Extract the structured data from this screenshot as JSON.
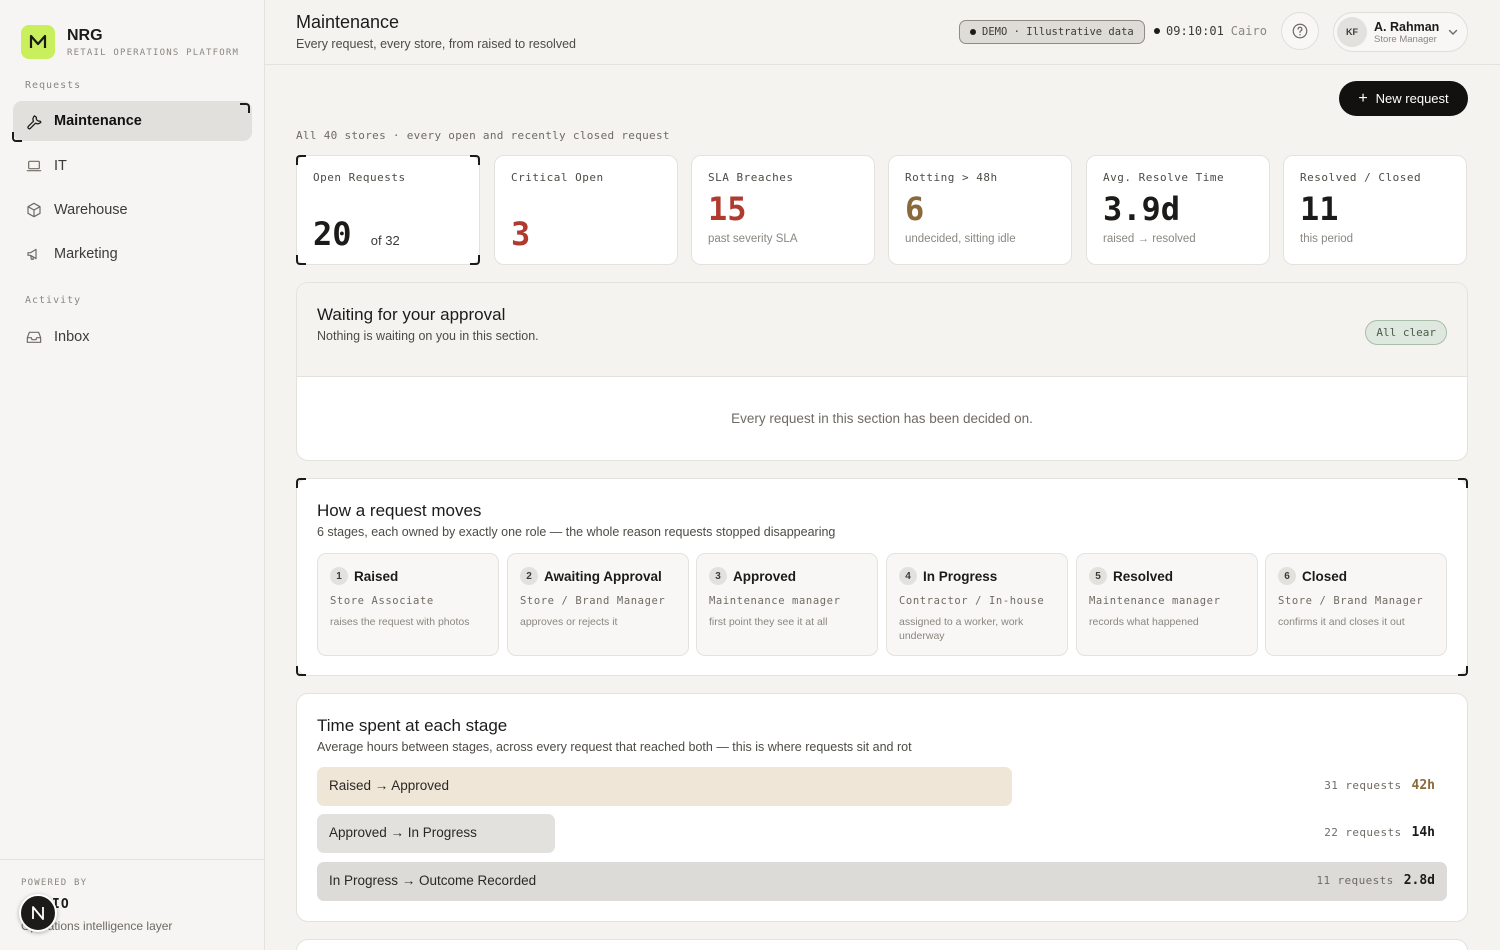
{
  "brand": {
    "name": "NRG",
    "subtitle": "RETAIL OPERATIONS PLATFORM",
    "logo_letter": "M",
    "accent": "#c9ef5c"
  },
  "sidebar": {
    "section_requests": "Requests",
    "section_activity": "Activity",
    "items": [
      {
        "label": "Maintenance",
        "icon": "wrench-icon",
        "active": true
      },
      {
        "label": "IT",
        "icon": "laptop-icon"
      },
      {
        "label": "Warehouse",
        "icon": "box-icon"
      },
      {
        "label": "Marketing",
        "icon": "megaphone-icon"
      },
      {
        "label": "Inbox",
        "icon": "inbox-icon"
      }
    ],
    "footer": {
      "powered_by": "POWERED BY",
      "name": "IO",
      "tagline": "Operations intelligence layer"
    },
    "fab_letter": "N"
  },
  "header": {
    "title": "Maintenance",
    "subtitle": "Every request, every store, from raised to resolved",
    "demo_badge": "DEMO · Illustrative data",
    "clock_time": "09:10:01",
    "clock_city": "Cairo",
    "user": {
      "initials": "KF",
      "name": "A. Rahman",
      "role": "Store Manager"
    }
  },
  "actions": {
    "new_request": "New request"
  },
  "scope_line": "All 40 stores · every open and recently closed request",
  "kpis": [
    {
      "label": "Open Requests",
      "value": "20",
      "of": "of 32",
      "sub": ""
    },
    {
      "label": "Critical Open",
      "value": "3",
      "sub": "",
      "color": "#b03a2e"
    },
    {
      "label": "SLA Breaches",
      "value": "15",
      "sub": "past severity SLA",
      "color": "#b03a2e"
    },
    {
      "label": "Rotting > 48h",
      "value": "6",
      "sub": "undecided, sitting idle",
      "color": "#8a6a3a"
    },
    {
      "label": "Avg. Resolve Time",
      "value": "3.9d",
      "sub": "raised → resolved"
    },
    {
      "label": "Resolved / Closed",
      "value": "11",
      "sub": "this period"
    }
  ],
  "approval": {
    "title": "Waiting for your approval",
    "subtitle": "Nothing is waiting on you in this section.",
    "badge": "All clear",
    "empty": "Every request in this section has been decided on."
  },
  "flow": {
    "title": "How a request moves",
    "subtitle": "6 stages, each owned by exactly one role — the whole reason requests stopped disappearing",
    "stages": [
      {
        "num": "1",
        "name": "Raised",
        "owner": "Store Associate",
        "desc": "raises the request with photos"
      },
      {
        "num": "2",
        "name": "Awaiting Approval",
        "owner": "Store / Brand Manager",
        "desc": "approves or rejects it"
      },
      {
        "num": "3",
        "name": "Approved",
        "owner": "Maintenance manager",
        "desc": "first point they see it at all"
      },
      {
        "num": "4",
        "name": "In Progress",
        "owner": "Contractor / In-house",
        "desc": "assigned to a worker, work underway"
      },
      {
        "num": "5",
        "name": "Resolved",
        "owner": "Maintenance manager",
        "desc": "records what happened"
      },
      {
        "num": "6",
        "name": "Closed",
        "owner": "Store / Brand Manager",
        "desc": "confirms it and closes it out"
      }
    ]
  },
  "timing": {
    "title": "Time spent at each stage",
    "subtitle": "Average hours between stages, across every request that reached both — this is where requests sit and rot",
    "rows": [
      {
        "label": "Raised → Approved",
        "count": "31 requests",
        "value": "42h",
        "fill": 0.615,
        "bar_color": "#f0e6d8",
        "value_color": "#8a6a3a"
      },
      {
        "label": "Approved → In Progress",
        "count": "22 requests",
        "value": "14h",
        "fill": 0.211,
        "bar_color": "#e3e1dd",
        "value_color": "#1c1b19"
      },
      {
        "label": "In Progress → Outcome Recorded",
        "count": "11 requests",
        "value": "2.8d",
        "fill": 1.0,
        "bar_color": "#dddbd7",
        "value_color": "#1c1b19"
      }
    ]
  }
}
